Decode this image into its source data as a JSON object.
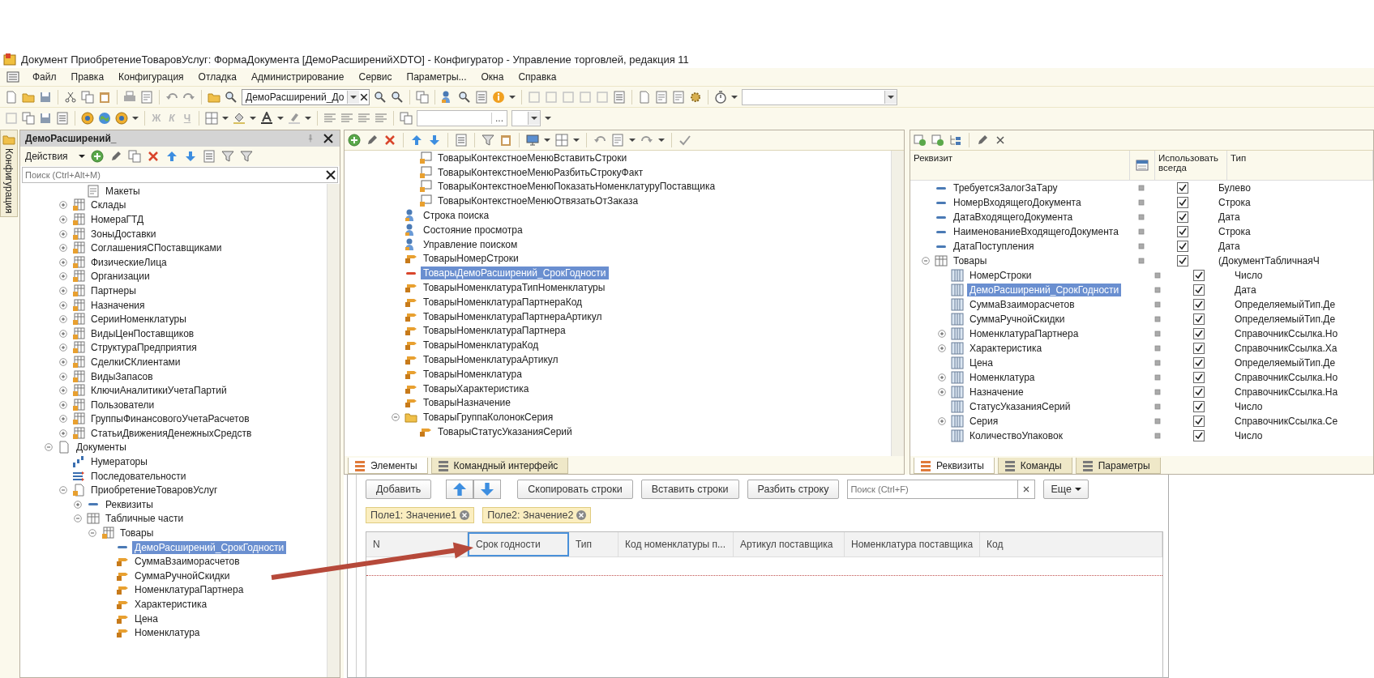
{
  "window": {
    "title": "Документ ПриобретениеТоваровУслуг: ФормаДокумента [ДемоРасширенийXDTO] - Конфигуратор - Управление торговлей, редакция 11"
  },
  "menu": [
    {
      "label": "Файл"
    },
    {
      "label": "Правка"
    },
    {
      "label": "Конфигурация"
    },
    {
      "label": "Отладка"
    },
    {
      "label": "Администрирование"
    },
    {
      "label": "Сервис"
    },
    {
      "label": "Параметры..."
    },
    {
      "label": "Окна"
    },
    {
      "label": "Справка"
    }
  ],
  "toolbar": {
    "search_combo": "ДемоРасширений_До",
    "format_buttons": [
      {
        "label": "Ж",
        "disabled": true
      },
      {
        "label": "К",
        "disabled": true
      },
      {
        "label": "Ч",
        "disabled": true
      }
    ],
    "field_button": "..."
  },
  "config_panel": {
    "side_tab": "Конфигурация",
    "title": "ДемоРасширений_",
    "actions": "Действия",
    "search": {
      "placeholder": "Поиск (Ctrl+Alt+M)"
    },
    "tree": [
      {
        "children": [
          {
            "children": [
              {
                "label": "Макеты",
                "kind": "layout",
                "selected": false
              }
            ]
          },
          {
            "label": "Склады",
            "kind": "catalog",
            "expanded": false,
            "selected": false
          },
          {
            "label": "НомераГТД",
            "kind": "catalog",
            "expanded": false,
            "selected": false
          },
          {
            "label": "ЗоныДоставки",
            "kind": "catalog",
            "expanded": false,
            "selected": false
          },
          {
            "label": "СоглашенияСПоставщиками",
            "kind": "catalog",
            "expanded": false,
            "selected": false
          },
          {
            "label": "ФизическиеЛица",
            "kind": "catalog",
            "expanded": false,
            "selected": false
          },
          {
            "label": "Организации",
            "kind": "catalog",
            "expanded": false,
            "selected": false
          },
          {
            "label": "Партнеры",
            "kind": "catalog",
            "expanded": false,
            "selected": false
          },
          {
            "label": "Назначения",
            "kind": "catalog",
            "expanded": false,
            "selected": false
          },
          {
            "label": "СерииНоменклатуры",
            "kind": "catalog",
            "expanded": false,
            "selected": false
          },
          {
            "label": "ВидыЦенПоставщиков",
            "kind": "catalog",
            "expanded": false,
            "selected": false
          },
          {
            "label": "СтруктураПредприятия",
            "kind": "catalog",
            "expanded": false,
            "selected": false
          },
          {
            "label": "СделкиСКлиентами",
            "kind": "catalog",
            "expanded": false,
            "selected": false
          },
          {
            "label": "ВидыЗапасов",
            "kind": "catalog",
            "expanded": false,
            "selected": false
          },
          {
            "label": "КлючиАналитикиУчетаПартий",
            "kind": "catalog",
            "expanded": false,
            "selected": false
          },
          {
            "label": "Пользователи",
            "kind": "catalog",
            "expanded": false,
            "selected": false
          },
          {
            "label": "ГруппыФинансовогоУчетаРасчетов",
            "kind": "catalog",
            "expanded": false,
            "selected": false
          },
          {
            "label": "СтатьиДвиженияДенежныхСредств",
            "kind": "catalog",
            "expanded": false,
            "selected": false
          }
        ]
      },
      {
        "label": "Документы",
        "kind": "document_group",
        "expanded": true,
        "selected": false,
        "children": [
          {
            "label": "Нумераторы",
            "kind": "numerator",
            "selected": false
          },
          {
            "label": "Последовательности",
            "kind": "sequence",
            "selected": false
          },
          {
            "label": "ПриобретениеТоваровУслуг",
            "kind": "document",
            "expanded": true,
            "selected": false,
            "children": [
              {
                "label": "Реквизиты",
                "kind": "attribute",
                "expanded": false,
                "selected": false
              },
              {
                "label": "Табличные части",
                "kind": "table",
                "expanded": true,
                "selected": false,
                "children": [
                  {
                    "label": "Товары",
                    "kind": "document_table",
                    "expanded": true,
                    "selected": false,
                    "children": [
                      {
                        "label": "ДемоРасширений_СрокГодности",
                        "kind": "attribute",
                        "selected": true
                      },
                      {
                        "label": "СуммаВзаиморасчетов",
                        "kind": "field",
                        "selected": false
                      },
                      {
                        "label": "СуммаРучнойСкидки",
                        "kind": "field",
                        "selected": false
                      },
                      {
                        "label": "НоменклатураПартнера",
                        "kind": "field",
                        "selected": false
                      },
                      {
                        "label": "Характеристика",
                        "kind": "field",
                        "selected": false
                      },
                      {
                        "label": "Цена",
                        "kind": "field",
                        "selected": false
                      },
                      {
                        "label": "Номенклатура",
                        "kind": "field",
                        "selected": false
                      }
                    ]
                  }
                ]
              }
            ]
          }
        ]
      }
    ]
  },
  "form_tree_panel": {
    "tree": [
      {
        "children": [
          {
            "label": "ТоварыКонтекстноеМенюВставитьСтроки",
            "kind": "command",
            "selected": false
          },
          {
            "label": "ТоварыКонтекстноеМенюРазбитьСтрокуФакт",
            "kind": "command",
            "selected": false
          },
          {
            "label": "ТоварыКонтекстноеМенюПоказатьНоменклатуруПоставщика",
            "kind": "command",
            "selected": false
          },
          {
            "label": "ТоварыКонтекстноеМенюОтвязатьОтЗаказа",
            "kind": "command",
            "selected": false
          }
        ]
      },
      {
        "label": "Строка поиска",
        "kind": "search_element",
        "selected": false
      },
      {
        "label": "Состояние просмотра",
        "kind": "search_element",
        "selected": false
      },
      {
        "label": "Управление поиском",
        "kind": "search_element",
        "selected": false
      },
      {
        "label": "ТоварыНомерСтроки",
        "kind": "field",
        "selected": false
      },
      {
        "label": "ТоварыДемоРасширений_СрокГодности",
        "kind": "added_attribute",
        "selected": true
      },
      {
        "label": "ТоварыНоменклатураТипНоменклатуры",
        "kind": "field",
        "selected": false
      },
      {
        "label": "ТоварыНоменклатураПартнераКод",
        "kind": "field",
        "selected": false
      },
      {
        "label": "ТоварыНоменклатураПартнераАртикул",
        "kind": "field",
        "selected": false
      },
      {
        "label": "ТоварыНоменклатураПартнера",
        "kind": "field",
        "selected": false
      },
      {
        "label": "ТоварыНоменклатураКод",
        "kind": "field",
        "selected": false
      },
      {
        "label": "ТоварыНоменклатураАртикул",
        "kind": "field",
        "selected": false
      },
      {
        "label": "ТоварыНоменклатура",
        "kind": "field",
        "selected": false
      },
      {
        "label": "ТоварыХарактеристика",
        "kind": "field",
        "selected": false
      },
      {
        "label": "ТоварыНазначение",
        "kind": "field",
        "selected": false
      },
      {
        "label": "ТоварыГруппаКолонокСерия",
        "kind": "folder",
        "expanded": true,
        "selected": false,
        "children": [
          {
            "label": "ТоварыСтатусУказанияСерий",
            "kind": "field",
            "selected": false
          }
        ]
      }
    ],
    "tabs": [
      {
        "label": "Элементы",
        "selected": true
      },
      {
        "label": "Командный интерфейс",
        "selected": false
      }
    ]
  },
  "attributes_panel": {
    "columns": [
      "Реквизит",
      "Использовать всегда",
      "Тип"
    ],
    "rows": [
      {
        "label": "ТребуетсяЗалогЗаТару",
        "kind": "attribute",
        "use_always": true,
        "type": "Булево",
        "selected": false
      },
      {
        "label": "НомерВходящегоДокумента",
        "kind": "attribute",
        "use_always": true,
        "type": "Строка",
        "selected": false
      },
      {
        "label": "ДатаВходящегоДокумента",
        "kind": "attribute",
        "use_always": true,
        "type": "Дата",
        "selected": false
      },
      {
        "label": "НаименованиеВходящегоДокумента",
        "kind": "attribute",
        "use_always": true,
        "type": "Строка",
        "selected": false
      },
      {
        "label": "ДатаПоступления",
        "kind": "attribute",
        "use_always": true,
        "type": "Дата",
        "selected": false
      },
      {
        "label": "Товары",
        "kind": "table",
        "expanded": true,
        "use_always": true,
        "type": "(ДокументТабличнаяЧ",
        "selected": false,
        "children": [
          {
            "label": "НомерСтроки",
            "kind": "column",
            "use_always": true,
            "type": "Число",
            "selected": false
          },
          {
            "label": "ДемоРасширений_СрокГодности",
            "kind": "column",
            "use_always": true,
            "type": "Дата",
            "selected": true
          },
          {
            "label": "СуммаВзаиморасчетов",
            "kind": "column",
            "use_always": true,
            "type": "ОпределяемыйТип.Де",
            "selected": false
          },
          {
            "label": "СуммаРучнойСкидки",
            "kind": "column",
            "use_always": true,
            "type": "ОпределяемыйТип.Де",
            "selected": false
          },
          {
            "label": "НоменклатураПартнера",
            "kind": "column",
            "expanded": false,
            "use_always": true,
            "type": "СправочникСсылка.Но",
            "selected": false
          },
          {
            "label": "Характеристика",
            "kind": "column",
            "expanded": false,
            "use_always": true,
            "type": "СправочникСсылка.Ха",
            "selected": false
          },
          {
            "label": "Цена",
            "kind": "column",
            "use_always": true,
            "type": "ОпределяемыйТип.Де",
            "selected": false
          },
          {
            "label": "Номенклатура",
            "kind": "column",
            "expanded": false,
            "use_always": true,
            "type": "СправочникСсылка.Но",
            "selected": false
          },
          {
            "label": "Назначение",
            "kind": "column",
            "expanded": false,
            "use_always": true,
            "type": "СправочникСсылка.На",
            "selected": false
          },
          {
            "label": "СтатусУказанияСерий",
            "kind": "column",
            "use_always": true,
            "type": "Число",
            "selected": false
          },
          {
            "label": "Серия",
            "kind": "column",
            "expanded": false,
            "use_always": true,
            "type": "СправочникСсылка.Се",
            "selected": false
          },
          {
            "label": "КоличествоУпаковок",
            "kind": "column",
            "use_always": true,
            "type": "Число",
            "selected": false
          }
        ]
      }
    ],
    "tabs": [
      {
        "label": "Реквизиты",
        "selected": true
      },
      {
        "label": "Команды",
        "selected": false
      },
      {
        "label": "Параметры",
        "selected": false
      }
    ]
  },
  "form_preview": {
    "add_button": "Добавить",
    "buttons": [
      "Скопировать строки",
      "Вставить строки",
      "Разбить строку"
    ],
    "search": {
      "placeholder": "Поиск (Ctrl+F)"
    },
    "more": "Еще",
    "filters": [
      "Поле1: Значение1",
      "Поле2: Значение2"
    ],
    "columns": [
      {
        "label": "N",
        "selected": false
      },
      {
        "label": "Срок годности",
        "selected": true
      },
      {
        "label": "Тип",
        "selected": false
      },
      {
        "label": "Код номенклатуры п...",
        "selected": false
      },
      {
        "label": "Артикул поставщика",
        "selected": false
      },
      {
        "label": "Номенклатура поставщика",
        "selected": false
      },
      {
        "label": "Код",
        "selected": false
      }
    ]
  }
}
